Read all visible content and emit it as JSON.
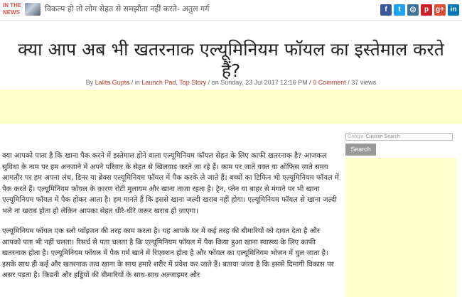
{
  "header": {
    "in_the_news": "IN THE NEWS",
    "news_text": "विकल्प हो तो लोग सेहत से समझौता नहीं करते- अतुल गर्ग",
    "socials": [
      {
        "name": "facebook-icon",
        "glyph": "f",
        "color": "#3b5998"
      },
      {
        "name": "twitter-icon",
        "glyph": "t",
        "color": "#1da1f2"
      },
      {
        "name": "instagram-icon",
        "glyph": "◎",
        "color": "#3f729b"
      },
      {
        "name": "pinterest-icon",
        "glyph": "p",
        "color": "#cb2027"
      },
      {
        "name": "googleplus-icon",
        "glyph": "g+",
        "color": "#dd4b39"
      },
      {
        "name": "linkedin-icon",
        "glyph": "in",
        "color": "#0077b5"
      }
    ]
  },
  "article": {
    "title": "क्या आप अब भी खतरनाक एल्यूमिनियम फॉयल का इस्तेमाल करते हैं?",
    "meta": {
      "by": "By",
      "author": "Lalita Gupta",
      "in": "/ in",
      "categories": "Launch Pad, Top Story",
      "on": "/ on Sunday, 23 Jul 2017 12:16 PM /",
      "comments": "0 Comment",
      "views": "/ 37 views"
    },
    "paragraphs": [
      "क्या आपको पाता है कि खाना पैक करने में इस्तेमाल होने वाला एल्यूमिनियम फॉयल सेहत के लिए काफी खतरनाक है? आजकल सुविधा के नाम पर हम अनजाने में अपने परिवार के सेहत से खिलवाड़ करते जा रहे हैं। काम पर जाते वक्त या ऑफिस जाते समय आमतौर पर हम अपना लंच, डिनर या ब्रेक्स एल्यूमिनियम फॉयल में पैक करके ले जाते हैं। बच्चों का टिफिन भी एल्यूमिनियम फॉयल में पैक करते हैं। एल्यूमिनियम फॉयल के कारण रोटी मुलायम और खाना ताजा रहता है। ट्रेन, प्लेन या बाहर से मंगाने पर भी खाना एल्यूमिनियम फॉयल में पैक होकर आता है। हम मानते हैं कि इससे खाना जल्दी खराब नहीं होगा। एल्यूमिनियम फॉयल से खाना जल्दी भले ना खराब होता हो लेकिन आपका सेहत धीरे-धीरे जरूर खराब हो जाएगा।",
      "एल्यूमिनियम फॉयल एक स्लो प्वॉइजन की तरह काम करता है। यह आपके घर में कई तरह की बीमारियों को दावत देता है और आपको पता भी नहीं चलता। रिसर्च से पता चलता है कि एल्यूमिनियम फॉयल में पैक किया हुआ खाना स्वास्थ्य के लिए काफी खतरनाक होता है। एल्यूमिनियम फॉयल में पैक गर्म खाने में रिएक्शन होता है और फॉयल का एल्यूमिनियम भोजन में घुल जाता है। इसके साथ ही कई और खतरनाक तत्व खाना के साथ हमारे शरीर में प्रवेश कर जाते हैं। बताया जाता है कि इससे दिमागी विकास पर असर पड़ता है। किडनी और हड्डियों की बीमारियों के साथ-साथ अल्जाइमर और"
    ]
  },
  "sidebar": {
    "search_google": "Google",
    "search_placeholder": "Custom Search",
    "search_button": "Search"
  }
}
